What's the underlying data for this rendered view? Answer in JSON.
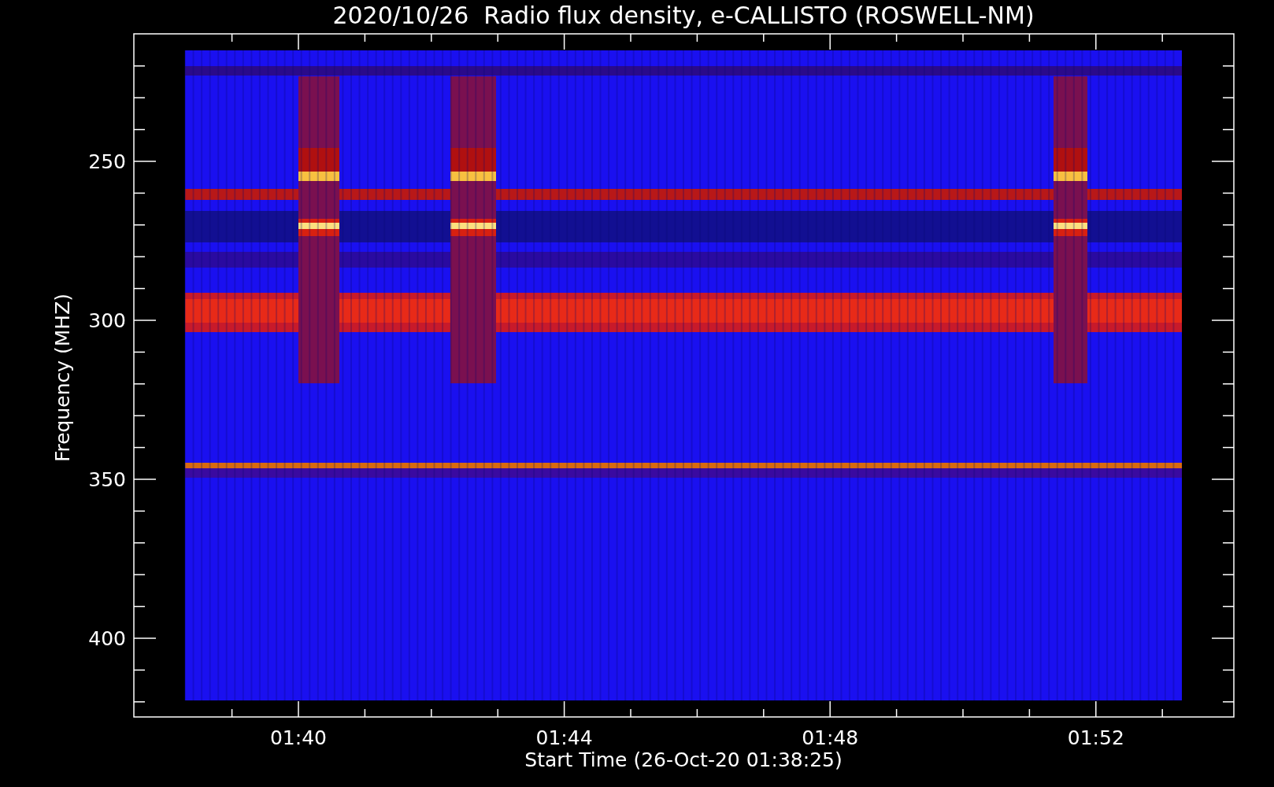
{
  "title": "2020/10/26  Radio flux density, e-CALLISTO (ROSWELL-NM)",
  "xlabel": "Start Time (26-Oct-20 01:38:25)",
  "ylabel": "Frequency (MHZ)",
  "xticks": [
    "01:40",
    "01:44",
    "01:48",
    "01:52"
  ],
  "yticks": [
    "250",
    "300",
    "350",
    "400"
  ]
}
